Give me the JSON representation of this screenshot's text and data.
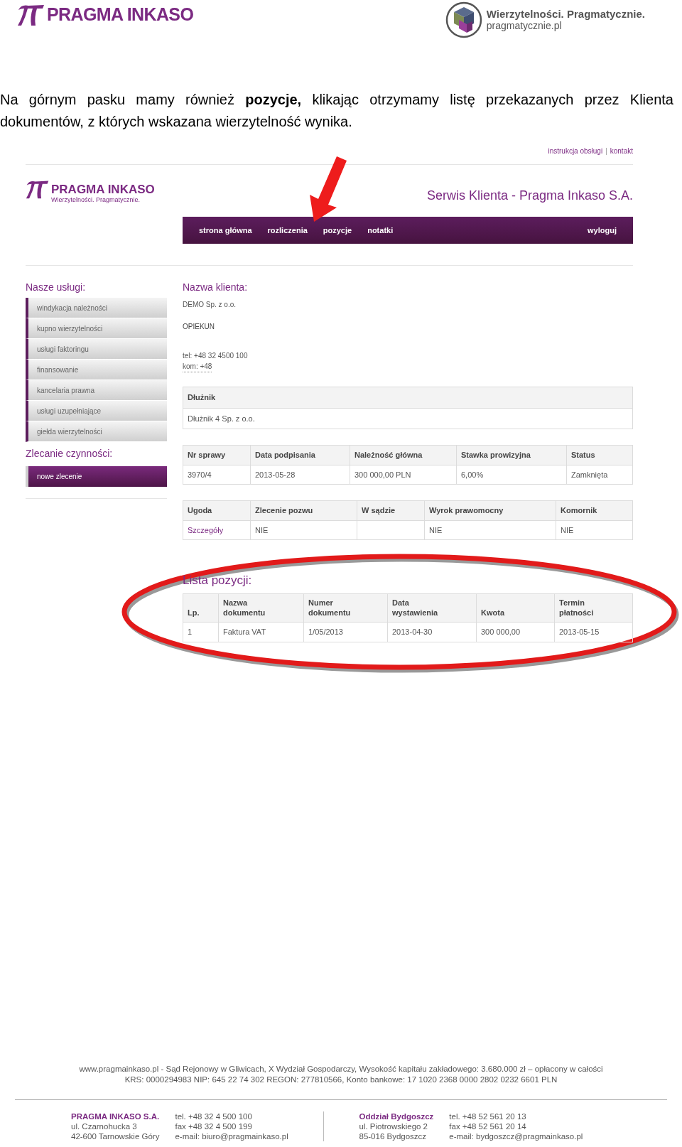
{
  "doc_header": {
    "brand": "PRAGMA INKASO",
    "tagline": "Wierzytelności. Pragmatycznie.",
    "site": "pragmatycznie.pl"
  },
  "intro": "Na górnym pasku mamy również **pozycje,** klikając otrzymamy listę przekazanych przez Klienta dokumentów, z których wskazana wierzytelność wynika.",
  "app": {
    "top_links": [
      "instrukcja obsługi",
      "kontakt"
    ],
    "top_links_separator": "|",
    "logo": {
      "brand": "PRAGMA INKASO",
      "tagline": "Wierzytelności. Pragmatycznie."
    },
    "title": "Serwis Klienta - Pragma Inkaso S.A.",
    "nav": {
      "items": [
        "strona główna",
        "rozliczenia",
        "pozycje",
        "notatki"
      ],
      "logout": "wyloguj"
    },
    "sidebar": {
      "services_title": "Nasze usługi:",
      "services": [
        "windykacja należności",
        "kupno wierzytelności",
        "usługi faktoringu",
        "finansowanie",
        "kancelaria prawna",
        "usługi uzupełniające",
        "giełda wierzytelności"
      ],
      "orders_title": "Zlecanie czynności:",
      "orders": [
        "nowe zlecenie"
      ]
    },
    "client": {
      "label": "Nazwa klienta:",
      "name": "DEMO Sp. z o.o.",
      "guardian_label": "OPIEKUN",
      "tel": "tel: +48 32 4500 100",
      "mobile": "kom: +48"
    },
    "debtor": {
      "label": "Dłużnik",
      "name": "Dłużnik 4 Sp. z o.o."
    },
    "case_table": {
      "columns": [
        "Nr sprawy",
        "Data podpisania",
        "Należność główna",
        "Stawka prowizyjna",
        "Status"
      ],
      "rows": [
        [
          "3970/4",
          "2013-05-28",
          "300 000,00 PLN",
          "6,00%",
          "Zamknięta"
        ]
      ]
    },
    "stage_table": {
      "columns": [
        "Ugoda",
        "Zlecenie pozwu",
        "W sądzie",
        "Wyrok prawomocny",
        "Komornik"
      ],
      "rows": [
        [
          {
            "text": "Szczegóły",
            "kind": "link"
          },
          {
            "text": "NIE",
            "kind": "text"
          },
          {
            "text": "",
            "kind": "text"
          },
          {
            "text": "NIE",
            "kind": "text"
          },
          {
            "text": "NIE",
            "kind": "text"
          }
        ]
      ]
    },
    "items": {
      "title": "Lista pozycji:",
      "columns": [
        "Lp.",
        "Nazwa dokumentu",
        "Numer dokumentu",
        "Data wystawienia",
        "Kwota",
        "Termin płatności"
      ],
      "rows": [
        [
          "1",
          "Faktura VAT",
          "1/05/2013",
          "2013-04-30",
          "300 000,00",
          "2013-05-15"
        ]
      ]
    }
  },
  "footer": {
    "legal": [
      "www.pragmainkaso.pl - Sąd Rejonowy w Gliwicach, X Wydział Gospodarczy, Wysokość kapitału zakładowego: 3.680.000 zł – opłacony w całości",
      "KRS: 0000294983  NIP: 645 22 74 302  REGON: 277810566, Konto bankowe: 17 1020 2368 0000 2802 0232 6601 PLN"
    ],
    "offices": [
      {
        "name": "PRAGMA INKASO S.A.",
        "address": [
          "ul. Czarnohucka 3",
          "42-600 Tarnowskie Góry"
        ],
        "contact": [
          "tel. +48 32 4 500 100",
          "fax +48 32 4 500 199",
          "e-mail: biuro@pragmainkaso.pl"
        ]
      },
      {
        "name": "Oddział Bydgoszcz",
        "address": [
          "ul. Piotrowskiego 2",
          "85-016 Bydgoszcz"
        ],
        "contact": [
          "tel. +48 52 561 20 13",
          "fax +48 52 561 20 14",
          "e-mail: bydgoszcz@pragmainkaso.pl"
        ]
      }
    ]
  }
}
